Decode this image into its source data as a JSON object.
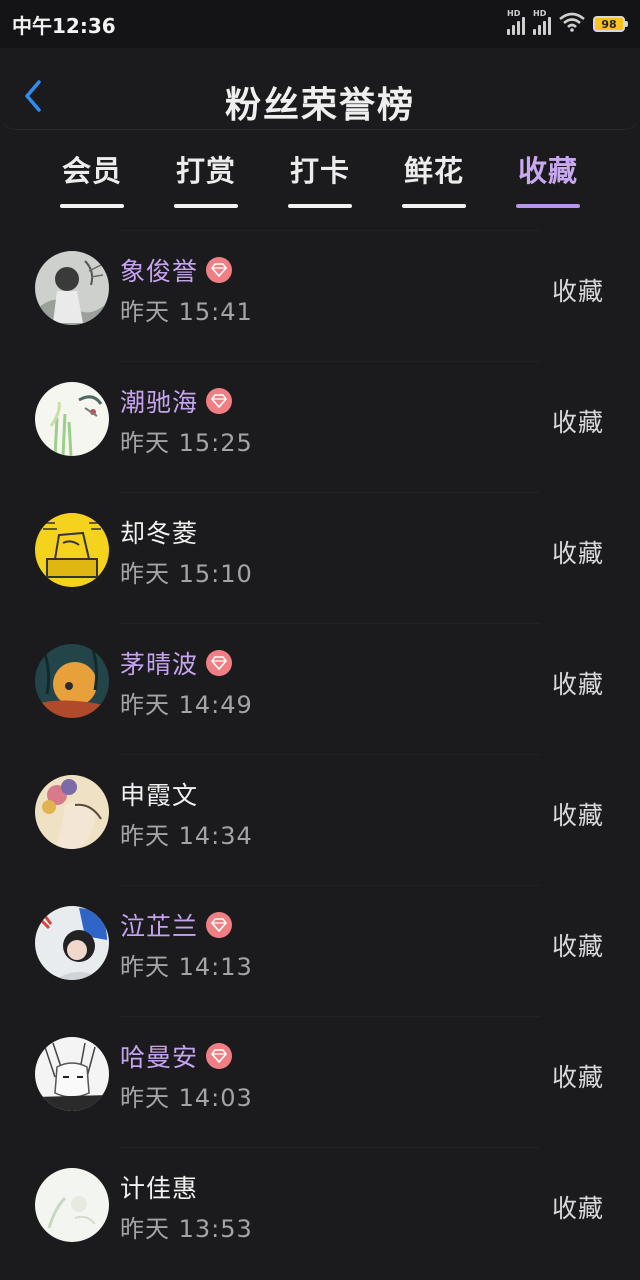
{
  "status_bar": {
    "time": "中午12:36",
    "battery": "98",
    "network_1": "HD",
    "network_2": "HD"
  },
  "header": {
    "title": "粉丝荣誉榜"
  },
  "tabs": [
    {
      "label": "会员"
    },
    {
      "label": "打赏"
    },
    {
      "label": "打卡"
    },
    {
      "label": "鲜花"
    },
    {
      "label": "收藏"
    }
  ],
  "active_tab": "收藏",
  "list": [
    {
      "name": "象俊誉",
      "time": "昨天 15:41",
      "action": "收藏",
      "vip": true
    },
    {
      "name": "潮驰海",
      "time": "昨天 15:25",
      "action": "收藏",
      "vip": true
    },
    {
      "name": "却冬菱",
      "time": "昨天 15:10",
      "action": "收藏",
      "vip": false
    },
    {
      "name": "茅晴波",
      "time": "昨天 14:49",
      "action": "收藏",
      "vip": true
    },
    {
      "name": "申霞文",
      "time": "昨天 14:34",
      "action": "收藏",
      "vip": false
    },
    {
      "name": "泣芷兰",
      "time": "昨天 14:13",
      "action": "收藏",
      "vip": true
    },
    {
      "name": "哈曼安",
      "time": "昨天 14:03",
      "action": "收藏",
      "vip": true
    },
    {
      "name": "计佳惠",
      "time": "昨天 13:53",
      "action": "收藏",
      "vip": false
    }
  ],
  "colors": {
    "background": "#1b1b1d",
    "accent": "#c8a8ef",
    "vip_badge": "#f07f83",
    "back_icon": "#2f8cf0"
  }
}
